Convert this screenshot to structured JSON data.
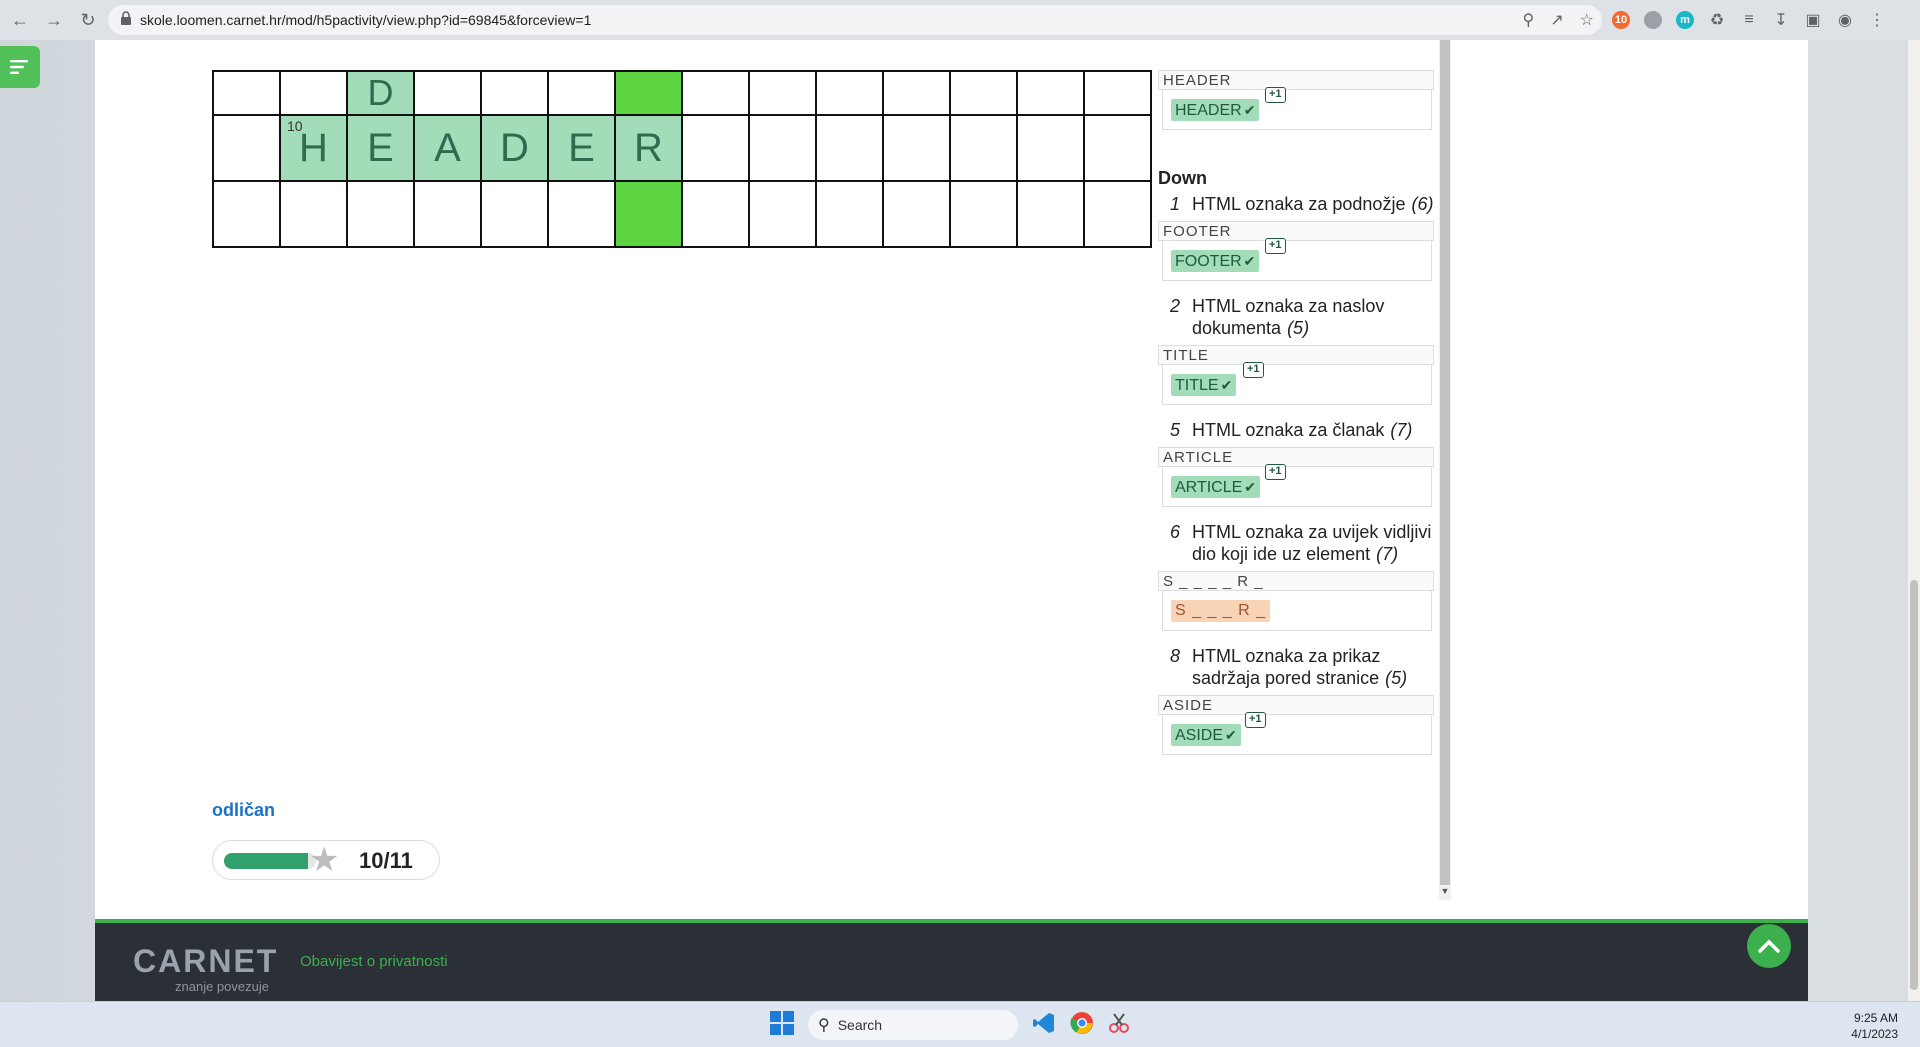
{
  "browser": {
    "url": "skole.loomen.carnet.hr/mod/h5pactivity/view.php?id=69845&forceview=1",
    "back_icon": "back-arrow-icon",
    "forward_icon": "forward-arrow-icon",
    "reload_icon": "reload-icon",
    "extensions": [
      {
        "letter": "10",
        "color": "#f36a2e"
      },
      {
        "letter": "",
        "color": "#9aa0a6"
      },
      {
        "letter": "m",
        "color": "#1ab7c4"
      }
    ]
  },
  "crossword": {
    "top_row_letter": "D",
    "header_number": "10",
    "header_letters": [
      "H",
      "E",
      "A",
      "D",
      "E",
      "R"
    ]
  },
  "clues": {
    "across_last": {
      "answer_label": "HEADER",
      "answer": "HEADER",
      "points": "+1"
    },
    "down_heading": "Down",
    "down": [
      {
        "number": "1",
        "text": "HTML oznaka za podnožje",
        "length": "(6)",
        "answer_label": "FOOTER",
        "answer": "FOOTER",
        "points": "+1",
        "correct": true
      },
      {
        "number": "2",
        "text": "HTML oznaka za naslov dokumenta",
        "length": "(5)",
        "answer_label": "TITLE",
        "answer": "TITLE",
        "points": "+1",
        "correct": true
      },
      {
        "number": "5",
        "text": "HTML oznaka za članak",
        "length": "(7)",
        "answer_label": "ARTICLE",
        "answer": "ARTICLE",
        "points": "+1",
        "correct": true
      },
      {
        "number": "6",
        "text": "HTML oznaka za uvijek vidljivi dio koji ide uz element",
        "length": "(7)",
        "answer_label": "S _ _ _ _ R _",
        "answer": "S _ _ _ R _",
        "points": "",
        "correct": false
      },
      {
        "number": "8",
        "text": "HTML oznaka za prikaz sadržaja pored stranice",
        "length": "(5)",
        "answer_label": "ASIDE",
        "answer": "ASIDE",
        "points": "+1",
        "correct": true
      }
    ]
  },
  "result": {
    "feedback": "odličan",
    "score": "10",
    "separator": "/",
    "max": "11",
    "progress_fraction": 0.909
  },
  "footer": {
    "logo": "CARNET",
    "tagline": "znanje povezuje",
    "privacy_link": "Obavijest o privatnosti"
  },
  "taskbar": {
    "search_label": "Search",
    "time": "9:25 AM",
    "date": "4/1/2023"
  },
  "colors": {
    "selected_cell": "#a3dcb9",
    "highlight_column": "#5dd442",
    "accent_green": "#3cb04c",
    "feedback_blue": "#1a73c7"
  }
}
